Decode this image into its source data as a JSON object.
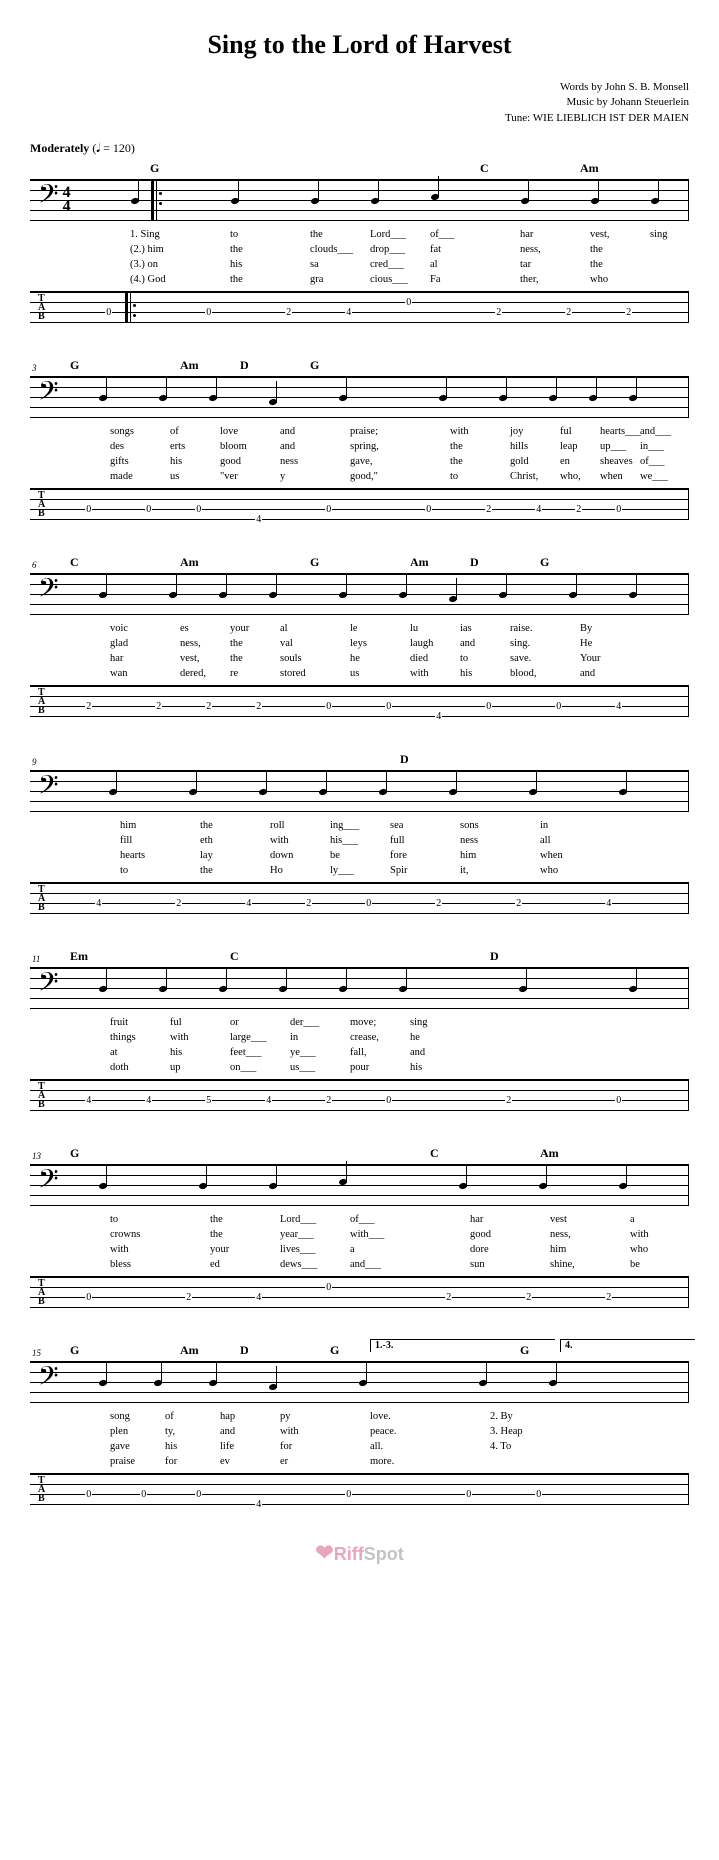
{
  "title": "Sing to the Lord of Harvest",
  "credits": {
    "words": "Words by John S. B. Monsell",
    "music": "Music by Johann Steuerlein",
    "tune": "Tune: WIE LIEBLICH IST DER MAIEN"
  },
  "tempo": {
    "label": "Moderately",
    "marking": "(𝅘𝅥 = 120)"
  },
  "timesig": {
    "top": "4",
    "bottom": "4"
  },
  "tab_label": [
    "T",
    "A",
    "B"
  ],
  "systems": [
    {
      "measure_num": "",
      "chords": [
        {
          "label": "G",
          "pos": 120
        },
        {
          "label": "C",
          "pos": 450
        },
        {
          "label": "Am",
          "pos": 550
        }
      ],
      "lyrics": [
        [
          "1. Sing",
          "to",
          "the",
          "Lord___",
          "of___",
          "har",
          "-",
          "vest,",
          "sing"
        ],
        [
          "(2.) him",
          "the",
          "clouds___",
          "drop___",
          "fat",
          "-",
          "ness,",
          "the"
        ],
        [
          "(3.) on",
          "his",
          "sa",
          "-",
          "cred___",
          "al",
          "-",
          "tar",
          "the"
        ],
        [
          "(4.) God",
          "the",
          "gra",
          "-",
          "cious___",
          "Fa",
          "-",
          "ther,",
          "who"
        ]
      ],
      "tab_nums": [
        {
          "val": "0",
          "string": 2,
          "pos": 60
        },
        {
          "val": "0",
          "string": 2,
          "pos": 160
        },
        {
          "val": "2",
          "string": 2,
          "pos": 240
        },
        {
          "val": "4",
          "string": 2,
          "pos": 300
        },
        {
          "val": "0",
          "string": 1,
          "pos": 360
        },
        {
          "val": "2",
          "string": 2,
          "pos": 450
        },
        {
          "val": "2",
          "string": 2,
          "pos": 520
        },
        {
          "val": "2",
          "string": 2,
          "pos": 580
        }
      ],
      "has_repeat_start": true
    },
    {
      "measure_num": "3",
      "chords": [
        {
          "label": "G",
          "pos": 40
        },
        {
          "label": "Am",
          "pos": 150
        },
        {
          "label": "D",
          "pos": 210
        },
        {
          "label": "G",
          "pos": 280
        }
      ],
      "lyrics": [
        [
          "songs",
          "of",
          "love",
          "and",
          "praise;",
          "with",
          "joy",
          "-",
          "ful",
          "hearts___",
          "and___"
        ],
        [
          "des",
          "-",
          "erts",
          "bloom",
          "and",
          "spring,",
          "the",
          "hills",
          "leap",
          "up___",
          "in___"
        ],
        [
          "gifts",
          "his",
          "good",
          "-",
          "ness",
          "gave,",
          "the",
          "gold",
          "-",
          "en",
          "sheaves",
          "of___"
        ],
        [
          "made",
          "us",
          "\"ver",
          "-",
          "y",
          "good,\"",
          "to",
          "Christ,",
          "who,",
          "when",
          "we___"
        ]
      ],
      "tab_nums": [
        {
          "val": "0",
          "string": 2,
          "pos": 40
        },
        {
          "val": "0",
          "string": 2,
          "pos": 100
        },
        {
          "val": "0",
          "string": 2,
          "pos": 150
        },
        {
          "val": "4",
          "string": 3,
          "pos": 210
        },
        {
          "val": "0",
          "string": 2,
          "pos": 280
        },
        {
          "val": "0",
          "string": 2,
          "pos": 380
        },
        {
          "val": "2",
          "string": 2,
          "pos": 440
        },
        {
          "val": "4",
          "string": 2,
          "pos": 490
        },
        {
          "val": "2",
          "string": 2,
          "pos": 530
        },
        {
          "val": "0",
          "string": 2,
          "pos": 570
        }
      ]
    },
    {
      "measure_num": "6",
      "chords": [
        {
          "label": "C",
          "pos": 40
        },
        {
          "label": "Am",
          "pos": 150
        },
        {
          "label": "G",
          "pos": 280
        },
        {
          "label": "Am",
          "pos": 380
        },
        {
          "label": "D",
          "pos": 440
        },
        {
          "label": "G",
          "pos": 510
        }
      ],
      "lyrics": [
        [
          "voic",
          "-",
          "es",
          "your",
          "al",
          "-",
          "le",
          "-",
          "lu",
          "-",
          "ias",
          "raise.",
          "By"
        ],
        [
          "glad",
          "-",
          "ness,",
          "the",
          "val",
          "-",
          "leys",
          "laugh",
          "and",
          "sing.",
          "He"
        ],
        [
          "har",
          "-",
          "vest,",
          "the",
          "souls",
          "he",
          "died",
          "to",
          "save.",
          "Your"
        ],
        [
          "wan",
          "-",
          "dered,",
          "re",
          "-",
          "stored",
          "us",
          "with",
          "his",
          "blood,",
          "and"
        ]
      ],
      "tab_nums": [
        {
          "val": "2",
          "string": 2,
          "pos": 40
        },
        {
          "val": "2",
          "string": 2,
          "pos": 110
        },
        {
          "val": "2",
          "string": 2,
          "pos": 160
        },
        {
          "val": "2",
          "string": 2,
          "pos": 210
        },
        {
          "val": "0",
          "string": 2,
          "pos": 280
        },
        {
          "val": "0",
          "string": 2,
          "pos": 340
        },
        {
          "val": "4",
          "string": 3,
          "pos": 390
        },
        {
          "val": "0",
          "string": 2,
          "pos": 440
        },
        {
          "val": "0",
          "string": 2,
          "pos": 510
        },
        {
          "val": "4",
          "string": 2,
          "pos": 570
        }
      ]
    },
    {
      "measure_num": "9",
      "chords": [
        {
          "label": "D",
          "pos": 370
        }
      ],
      "lyrics": [
        [
          "him",
          "the",
          "roll",
          "-",
          "ing___",
          "sea",
          "-",
          "sons",
          "in"
        ],
        [
          "fill",
          "-",
          "eth",
          "with",
          "his___",
          "full",
          "-",
          "ness",
          "all"
        ],
        [
          "hearts",
          "lay",
          "down",
          "be",
          "-",
          "fore",
          "him",
          "when"
        ],
        [
          "to",
          "the",
          "Ho",
          "-",
          "ly___",
          "Spir",
          "-",
          "it,",
          "who"
        ]
      ],
      "tab_nums": [
        {
          "val": "4",
          "string": 2,
          "pos": 50
        },
        {
          "val": "2",
          "string": 2,
          "pos": 130
        },
        {
          "val": "4",
          "string": 2,
          "pos": 200
        },
        {
          "val": "2",
          "string": 2,
          "pos": 260
        },
        {
          "val": "0",
          "string": 2,
          "pos": 320
        },
        {
          "val": "2",
          "string": 2,
          "pos": 390
        },
        {
          "val": "2",
          "string": 2,
          "pos": 470
        },
        {
          "val": "4",
          "string": 2,
          "pos": 560
        }
      ]
    },
    {
      "measure_num": "11",
      "chords": [
        {
          "label": "Em",
          "pos": 40
        },
        {
          "label": "C",
          "pos": 200
        },
        {
          "label": "D",
          "pos": 460
        }
      ],
      "lyrics": [
        [
          "fruit",
          "-",
          "ful",
          "or",
          "-",
          "der___",
          "move;",
          "sing"
        ],
        [
          "things",
          "with",
          "large___",
          "in",
          "-",
          "crease,",
          "he"
        ],
        [
          "at",
          "his",
          "feet___",
          "ye___",
          "fall,",
          "and"
        ],
        [
          "doth",
          "up",
          "-",
          "on___",
          "us___",
          "pour",
          "his"
        ]
      ],
      "tab_nums": [
        {
          "val": "4",
          "string": 2,
          "pos": 40
        },
        {
          "val": "4",
          "string": 2,
          "pos": 100
        },
        {
          "val": "5",
          "string": 2,
          "pos": 160
        },
        {
          "val": "4",
          "string": 2,
          "pos": 220
        },
        {
          "val": "2",
          "string": 2,
          "pos": 280
        },
        {
          "val": "0",
          "string": 2,
          "pos": 340
        },
        {
          "val": "2",
          "string": 2,
          "pos": 460
        },
        {
          "val": "0",
          "string": 2,
          "pos": 570
        }
      ]
    },
    {
      "measure_num": "13",
      "chords": [
        {
          "label": "G",
          "pos": 40
        },
        {
          "label": "C",
          "pos": 400
        },
        {
          "label": "Am",
          "pos": 510
        }
      ],
      "lyrics": [
        [
          "to",
          "the",
          "Lord___",
          "of___",
          "har",
          "-",
          "vest",
          "a"
        ],
        [
          "crowns",
          "the",
          "year___",
          "with___",
          "good",
          "-",
          "ness,",
          "with"
        ],
        [
          "with",
          "your",
          "lives___",
          "a",
          "-",
          "dore",
          "him",
          "who"
        ],
        [
          "bless",
          "-",
          "ed",
          "dews___",
          "and___",
          "sun",
          "-",
          "shine,",
          "be"
        ]
      ],
      "tab_nums": [
        {
          "val": "0",
          "string": 2,
          "pos": 40
        },
        {
          "val": "2",
          "string": 2,
          "pos": 140
        },
        {
          "val": "4",
          "string": 2,
          "pos": 210
        },
        {
          "val": "0",
          "string": 1,
          "pos": 280
        },
        {
          "val": "2",
          "string": 2,
          "pos": 400
        },
        {
          "val": "2",
          "string": 2,
          "pos": 480
        },
        {
          "val": "2",
          "string": 2,
          "pos": 560
        }
      ]
    },
    {
      "measure_num": "15",
      "chords": [
        {
          "label": "G",
          "pos": 40
        },
        {
          "label": "Am",
          "pos": 150
        },
        {
          "label": "D",
          "pos": 210
        },
        {
          "label": "G",
          "pos": 300
        },
        {
          "label": "G",
          "pos": 490
        }
      ],
      "voltas": [
        {
          "label": "1.-3.",
          "pos": 290,
          "width": 180
        },
        {
          "label": "4.",
          "pos": 480,
          "width": 130
        }
      ],
      "lyrics": [
        [
          "song",
          "of",
          "hap",
          "-",
          "py",
          "love.",
          "2. By",
          ""
        ],
        [
          "plen",
          "-",
          "ty,",
          "and",
          "with",
          "peace.",
          "3. Heap",
          ""
        ],
        [
          "gave",
          "his",
          "life",
          "for",
          "all.",
          "4. To",
          ""
        ],
        [
          "praise",
          "for",
          "-",
          "ev",
          "-",
          "er",
          "-",
          "more."
        ]
      ],
      "tab_nums": [
        {
          "val": "0",
          "string": 2,
          "pos": 40
        },
        {
          "val": "0",
          "string": 2,
          "pos": 95
        },
        {
          "val": "0",
          "string": 2,
          "pos": 150
        },
        {
          "val": "4",
          "string": 3,
          "pos": 210
        },
        {
          "val": "0",
          "string": 2,
          "pos": 300
        },
        {
          "val": "0",
          "string": 2,
          "pos": 420
        },
        {
          "val": "0",
          "string": 2,
          "pos": 490
        }
      ]
    }
  ],
  "watermark": {
    "brand": "Riff",
    "suffix": "Spot"
  }
}
